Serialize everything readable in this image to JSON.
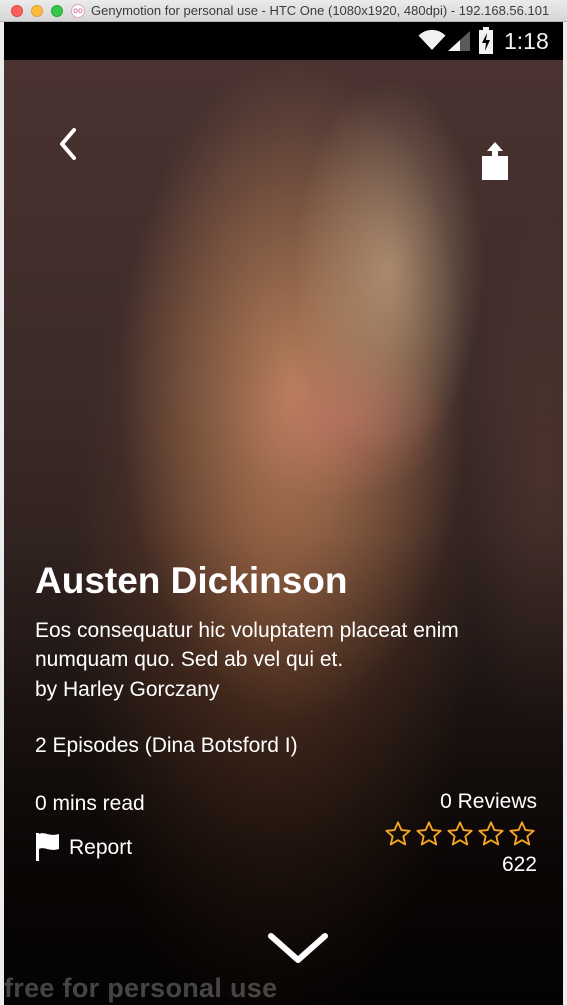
{
  "window": {
    "title": "Genymotion for personal use - HTC One (1080x1920, 480dpi) - 192.168.56.101",
    "app_icon": "genymotion-icon"
  },
  "status_bar": {
    "time": "1:18",
    "icons": [
      "wifi-icon",
      "signal-icon",
      "battery-charging-icon"
    ]
  },
  "toolbar": {
    "back_icon": "chevron-left-icon",
    "share_icon": "share-icon"
  },
  "story": {
    "title": "Austen Dickinson",
    "description": "Eos consequatur hic voluptatem placeat enim numquam quo. Sed ab vel qui et.",
    "author": "by Harley Gorczany",
    "episodes": "2 Episodes (Dina Botsford I)",
    "read_time": "0 mins read",
    "reviews": "0 Reviews",
    "rating": {
      "value": 0,
      "max": 5,
      "star_color": "#f5a623"
    },
    "count": "622"
  },
  "actions": {
    "report_label": "Report",
    "report_icon": "flag-icon",
    "expand_icon": "chevron-down-icon"
  },
  "watermark": "free for personal use",
  "colors": {
    "text": "#ffffff",
    "star": "#f5a623",
    "status_bar": "#000000"
  }
}
